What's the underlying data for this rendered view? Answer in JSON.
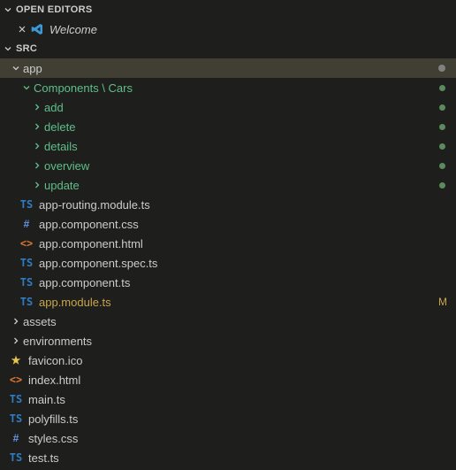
{
  "sections": {
    "open_editors": "OPEN EDITORS",
    "src": "SRC"
  },
  "open_editors": {
    "tabs": [
      {
        "label": "Welcome",
        "italic": true,
        "icon": "vscode"
      }
    ]
  },
  "tree": {
    "app": {
      "label": "app",
      "children": {
        "components_cars": "Components \\ Cars",
        "add": "add",
        "delete": "delete",
        "details": "details",
        "overview": "overview",
        "update": "update"
      },
      "files": {
        "routing": "app-routing.module.ts",
        "cmp_css": "app.component.css",
        "cmp_html": "app.component.html",
        "cmp_spec": "app.component.spec.ts",
        "cmp_ts": "app.component.ts",
        "module": "app.module.ts"
      }
    },
    "assets": "assets",
    "environments": "environments",
    "favicon": "favicon.ico",
    "index_html": "index.html",
    "main_ts": "main.ts",
    "polyfills": "polyfills.ts",
    "styles_css": "styles.css",
    "test_ts": "test.ts"
  },
  "badges": {
    "m": "M"
  }
}
